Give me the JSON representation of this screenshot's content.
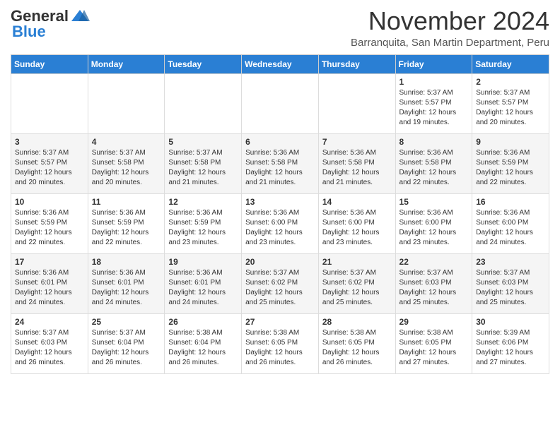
{
  "logo": {
    "general": "General",
    "blue": "Blue"
  },
  "header": {
    "title": "November 2024",
    "location": "Barranquita, San Martin Department, Peru"
  },
  "days_of_week": [
    "Sunday",
    "Monday",
    "Tuesday",
    "Wednesday",
    "Thursday",
    "Friday",
    "Saturday"
  ],
  "weeks": [
    [
      {
        "day": "",
        "info": ""
      },
      {
        "day": "",
        "info": ""
      },
      {
        "day": "",
        "info": ""
      },
      {
        "day": "",
        "info": ""
      },
      {
        "day": "",
        "info": ""
      },
      {
        "day": "1",
        "info": "Sunrise: 5:37 AM\nSunset: 5:57 PM\nDaylight: 12 hours\nand 19 minutes."
      },
      {
        "day": "2",
        "info": "Sunrise: 5:37 AM\nSunset: 5:57 PM\nDaylight: 12 hours\nand 20 minutes."
      }
    ],
    [
      {
        "day": "3",
        "info": "Sunrise: 5:37 AM\nSunset: 5:57 PM\nDaylight: 12 hours\nand 20 minutes."
      },
      {
        "day": "4",
        "info": "Sunrise: 5:37 AM\nSunset: 5:58 PM\nDaylight: 12 hours\nand 20 minutes."
      },
      {
        "day": "5",
        "info": "Sunrise: 5:37 AM\nSunset: 5:58 PM\nDaylight: 12 hours\nand 21 minutes."
      },
      {
        "day": "6",
        "info": "Sunrise: 5:36 AM\nSunset: 5:58 PM\nDaylight: 12 hours\nand 21 minutes."
      },
      {
        "day": "7",
        "info": "Sunrise: 5:36 AM\nSunset: 5:58 PM\nDaylight: 12 hours\nand 21 minutes."
      },
      {
        "day": "8",
        "info": "Sunrise: 5:36 AM\nSunset: 5:58 PM\nDaylight: 12 hours\nand 22 minutes."
      },
      {
        "day": "9",
        "info": "Sunrise: 5:36 AM\nSunset: 5:59 PM\nDaylight: 12 hours\nand 22 minutes."
      }
    ],
    [
      {
        "day": "10",
        "info": "Sunrise: 5:36 AM\nSunset: 5:59 PM\nDaylight: 12 hours\nand 22 minutes."
      },
      {
        "day": "11",
        "info": "Sunrise: 5:36 AM\nSunset: 5:59 PM\nDaylight: 12 hours\nand 22 minutes."
      },
      {
        "day": "12",
        "info": "Sunrise: 5:36 AM\nSunset: 5:59 PM\nDaylight: 12 hours\nand 23 minutes."
      },
      {
        "day": "13",
        "info": "Sunrise: 5:36 AM\nSunset: 6:00 PM\nDaylight: 12 hours\nand 23 minutes."
      },
      {
        "day": "14",
        "info": "Sunrise: 5:36 AM\nSunset: 6:00 PM\nDaylight: 12 hours\nand 23 minutes."
      },
      {
        "day": "15",
        "info": "Sunrise: 5:36 AM\nSunset: 6:00 PM\nDaylight: 12 hours\nand 23 minutes."
      },
      {
        "day": "16",
        "info": "Sunrise: 5:36 AM\nSunset: 6:00 PM\nDaylight: 12 hours\nand 24 minutes."
      }
    ],
    [
      {
        "day": "17",
        "info": "Sunrise: 5:36 AM\nSunset: 6:01 PM\nDaylight: 12 hours\nand 24 minutes."
      },
      {
        "day": "18",
        "info": "Sunrise: 5:36 AM\nSunset: 6:01 PM\nDaylight: 12 hours\nand 24 minutes."
      },
      {
        "day": "19",
        "info": "Sunrise: 5:36 AM\nSunset: 6:01 PM\nDaylight: 12 hours\nand 24 minutes."
      },
      {
        "day": "20",
        "info": "Sunrise: 5:37 AM\nSunset: 6:02 PM\nDaylight: 12 hours\nand 25 minutes."
      },
      {
        "day": "21",
        "info": "Sunrise: 5:37 AM\nSunset: 6:02 PM\nDaylight: 12 hours\nand 25 minutes."
      },
      {
        "day": "22",
        "info": "Sunrise: 5:37 AM\nSunset: 6:03 PM\nDaylight: 12 hours\nand 25 minutes."
      },
      {
        "day": "23",
        "info": "Sunrise: 5:37 AM\nSunset: 6:03 PM\nDaylight: 12 hours\nand 25 minutes."
      }
    ],
    [
      {
        "day": "24",
        "info": "Sunrise: 5:37 AM\nSunset: 6:03 PM\nDaylight: 12 hours\nand 26 minutes."
      },
      {
        "day": "25",
        "info": "Sunrise: 5:37 AM\nSunset: 6:04 PM\nDaylight: 12 hours\nand 26 minutes."
      },
      {
        "day": "26",
        "info": "Sunrise: 5:38 AM\nSunset: 6:04 PM\nDaylight: 12 hours\nand 26 minutes."
      },
      {
        "day": "27",
        "info": "Sunrise: 5:38 AM\nSunset: 6:05 PM\nDaylight: 12 hours\nand 26 minutes."
      },
      {
        "day": "28",
        "info": "Sunrise: 5:38 AM\nSunset: 6:05 PM\nDaylight: 12 hours\nand 26 minutes."
      },
      {
        "day": "29",
        "info": "Sunrise: 5:38 AM\nSunset: 6:05 PM\nDaylight: 12 hours\nand 27 minutes."
      },
      {
        "day": "30",
        "info": "Sunrise: 5:39 AM\nSunset: 6:06 PM\nDaylight: 12 hours\nand 27 minutes."
      }
    ]
  ]
}
